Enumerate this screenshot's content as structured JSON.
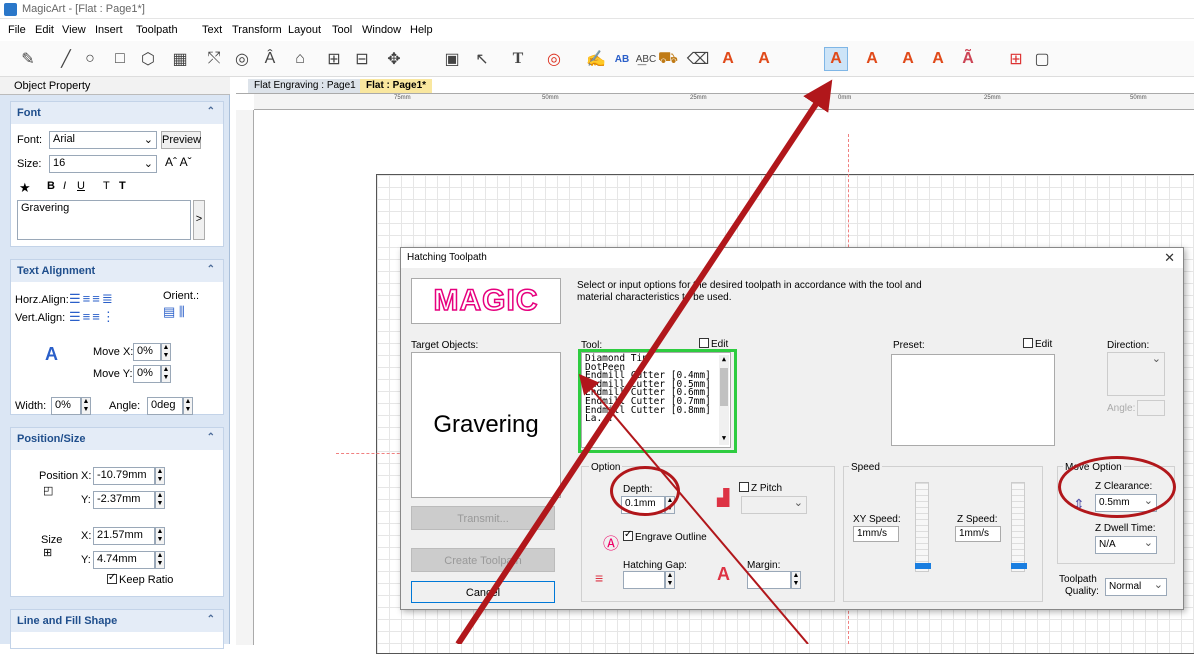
{
  "window": {
    "title": "MagicArt - [Flat : Page1*]"
  },
  "menu": [
    "File",
    "Edit",
    "View",
    "Insert",
    "Toolpath",
    "Text",
    "Transform",
    "Layout",
    "Tool",
    "Window",
    "Help"
  ],
  "left_panel": {
    "header": "Object Property",
    "font": {
      "title": "Font",
      "font_label": "Font:",
      "font_value": "Arial",
      "preview": "Preview",
      "size_label": "Size:",
      "size_value": "16",
      "text": "Gravering",
      "style_b": "B",
      "style_i": "I",
      "style_u": "U",
      "tt1": "T",
      "tt2": "T",
      "arrow": ">"
    },
    "align": {
      "title": "Text Alignment",
      "horz": "Horz.Align:",
      "vert": "Vert.Align:",
      "orient": "Orient.:",
      "movex_label": "Move X:",
      "movex": "0%",
      "movey_label": "Move Y:",
      "movey": "0%",
      "width_label": "Width:",
      "width": "0%",
      "angle_label": "Angle:",
      "angle": "0deg"
    },
    "position": {
      "title": "Position/Size",
      "pos_label": "Position",
      "x_label": "X:",
      "pos_x": "-10.79mm",
      "y_label": "Y:",
      "pos_y": "-2.37mm",
      "size_label": "Size",
      "size_x": "21.57mm",
      "size_y": "4.74mm",
      "keep_ratio": "Keep Ratio"
    },
    "line": {
      "title": "Line and Fill Shape"
    }
  },
  "tabs": [
    "Flat Engraving : Page1",
    "Flat : Page1*"
  ],
  "ruler": [
    "75mm",
    "50mm",
    "25mm",
    "0mm",
    "25mm",
    "50mm"
  ],
  "dialog": {
    "title": "Hatching Toolpath",
    "logo": "MAGIC",
    "description": "Select or input options for the desired toolpath in accordance with the tool and material characteristics to be used.",
    "target_label": "Target Objects:",
    "target_text": "Gravering",
    "tool_label": "Tool:",
    "edit": "Edit",
    "tools": [
      "Diamond Tip",
      "DotPeen",
      "Endmill Cutter [0.4mm]",
      "Endmill Cutter [0.5mm]",
      "Endmill Cutter [0.6mm]",
      "Endmill Cutter [0.7mm]",
      "Endmill Cutter [0.8mm]",
      "La..."
    ],
    "preset_label": "Preset:",
    "direction_label": "Direction:",
    "angle_label": "Angle:",
    "option_label": "Option",
    "depth_label": "Depth:",
    "depth_value": "0.1mm",
    "zpitch_label": "Z Pitch",
    "engrave_outline": "Engrave Outline",
    "hatching_gap_label": "Hatching Gap:",
    "margin_label": "Margin:",
    "speed_label": "Speed",
    "xy_speed_label": "XY Speed:",
    "xy_speed": "1mm/s",
    "z_speed_label": "Z Speed:",
    "z_speed": "1mm/s",
    "move_option_label": "Move Option",
    "z_clearance_label": "Z Clearance:",
    "z_clearance": "0.5mm",
    "z_dwell_label": "Z Dwell Time:",
    "z_dwell": "N/A",
    "quality_label1": "Toolpath",
    "quality_label2": "Quality:",
    "quality": "Normal",
    "transmit": "Transmit...",
    "create": "Create Toolpath",
    "cancel": "Cancel"
  },
  "colors": {
    "annotation_red": "#b1171b",
    "annotation_green": "#2ecc40",
    "logo_pink": "#e6007e"
  }
}
